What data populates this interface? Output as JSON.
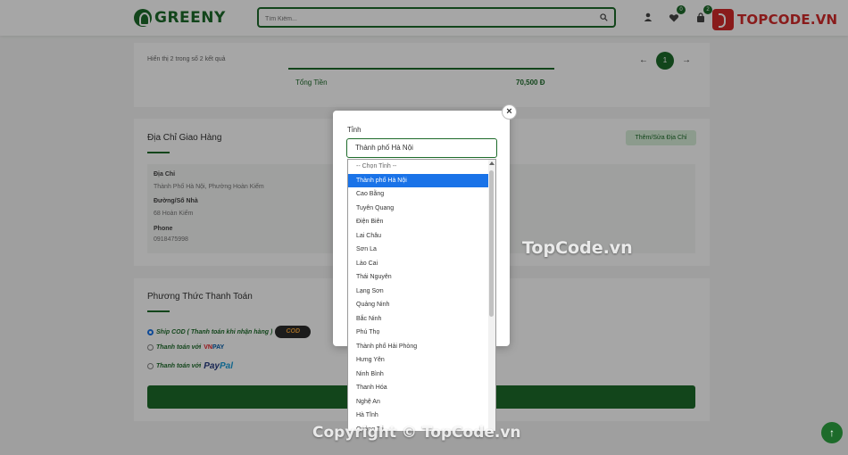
{
  "header": {
    "logo_text": "GREENY",
    "search_placeholder": "Tìm Kiếm...",
    "wishlist_count": "0",
    "cart_count": "2",
    "partner_logo": "TOPCODE.VN"
  },
  "summary": {
    "showing_text": "Hiển thị 2 trong số 2 kết quả",
    "total_label": "Tổng Tiền",
    "total_value": "70,500 Đ",
    "page_current": "1",
    "prev_arrow": "←",
    "next_arrow": "→"
  },
  "address": {
    "title": "Địa Chỉ Giao Hàng",
    "edit_button": "Thêm/Sửa Địa Chỉ",
    "fields": [
      {
        "label": "Địa Chỉ",
        "value": "Thành Phố Hà Nội, Phường Hoàn Kiếm"
      },
      {
        "label": "Đường/Số Nhà",
        "value": "68 Hoàn Kiếm"
      },
      {
        "label": "Phone",
        "value": "0918475998"
      }
    ]
  },
  "payment": {
    "title": "Phương Thức Thanh Toán",
    "options": [
      {
        "label": "Ship COD ( Thanh toán khi nhận hàng )",
        "badge": "COD",
        "selected": true
      },
      {
        "label": "Thanh toán với",
        "badge_vn": "VN",
        "badge_pay": "PAY",
        "selected": false
      },
      {
        "label": "Thanh toán với",
        "badge_p1": "Pay",
        "badge_p2": "Pal",
        "selected": false
      }
    ]
  },
  "modal": {
    "label": "Tỉnh",
    "selected_value": "Thành phố Hà Nội",
    "close_symbol": "×",
    "options": [
      "-- Chọn Tỉnh --",
      "Thành phố Hà Nội",
      "Cao Bằng",
      "Tuyên Quang",
      "Điện Biên",
      "Lai Châu",
      "Sơn La",
      "Lào Cai",
      "Thái Nguyên",
      "Lạng Sơn",
      "Quảng Ninh",
      "Bắc Ninh",
      "Phú Thọ",
      "Thành phố Hải Phòng",
      "Hưng Yên",
      "Ninh Bình",
      "Thanh Hóa",
      "Nghệ An",
      "Hà Tĩnh",
      "Quảng Trị"
    ]
  },
  "watermarks": {
    "center": "TopCode.vn",
    "bottom": "Copyright © TopCode.vn"
  },
  "scroll_top_symbol": "↑",
  "colors": {
    "brand": "#1d6b2a",
    "selected_option": "#1a73e8"
  }
}
